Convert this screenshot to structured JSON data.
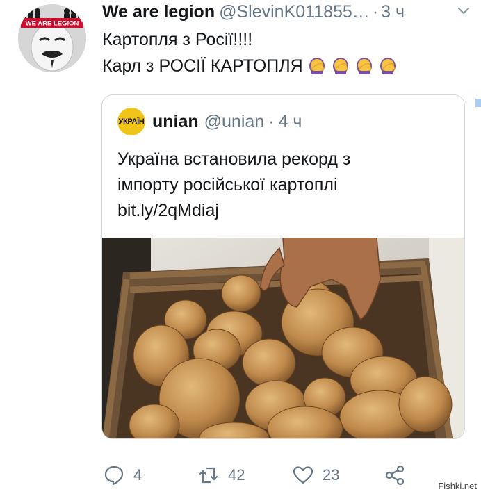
{
  "tweet": {
    "display_name": "We are legion",
    "handle": "@SlevinK011855…",
    "separator": "·",
    "time": "3 ч",
    "avatar_text": "WE ARE LEGION",
    "text_line1": "Картопля з Росії!!!!",
    "text_line2": "Карл з РОСІЇ КАРТОПЛЯ",
    "emoji_name": "woman-facepalming",
    "emoji_count": 4
  },
  "quote": {
    "avatar_text": "УКРАЇН",
    "display_name": "unian",
    "handle": "@unian",
    "separator": "·",
    "time": "4 ч",
    "text_line1": "Україна встановила рекорд з",
    "text_line2": "імпорту російської картоплі",
    "link": "bit.ly/2qMdiaj",
    "image_subject": "hand reaching into a wooden crate of potatoes"
  },
  "actions": {
    "reply_count": "4",
    "retweet_count": "42",
    "like_count": "23"
  },
  "watermark": "Fishki.net",
  "colors": {
    "text": "#14171a",
    "muted": "#657786",
    "border": "#cfd9de",
    "accent_edge": "#a9cdf0"
  }
}
